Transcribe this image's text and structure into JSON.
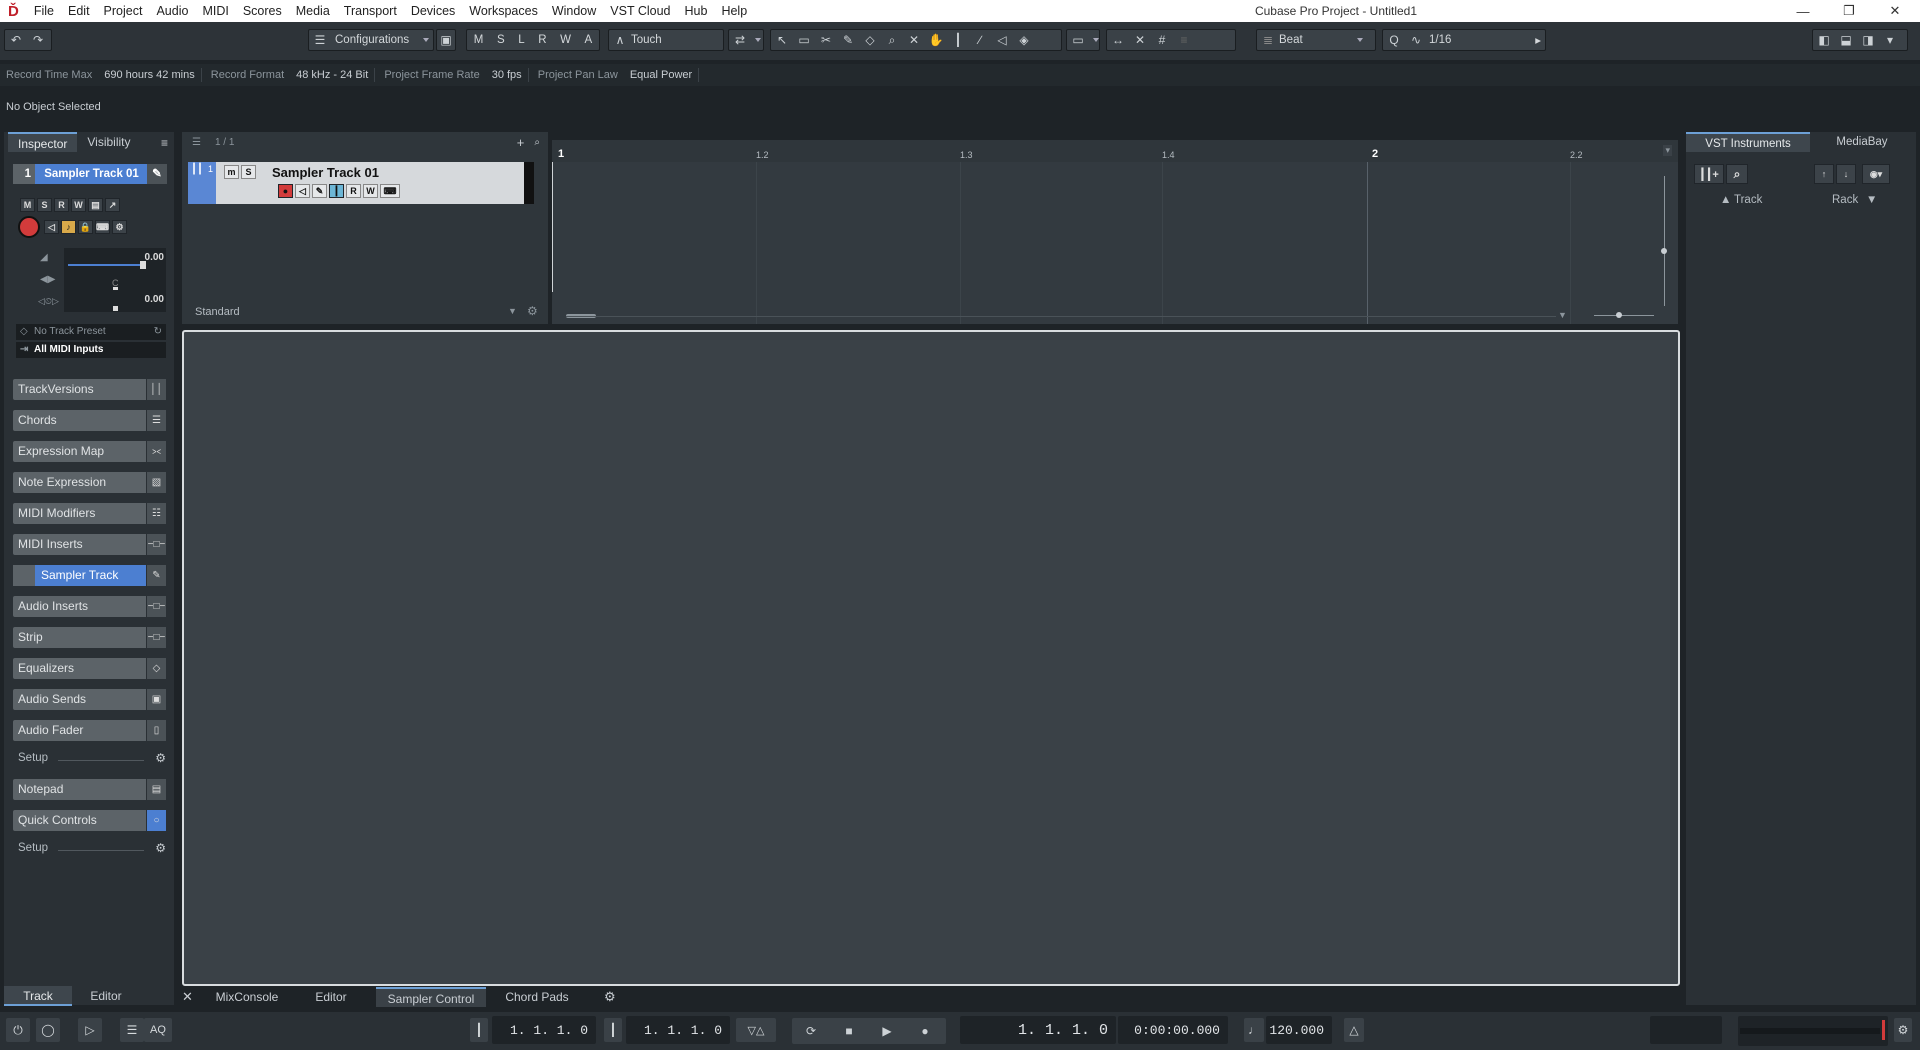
{
  "app": {
    "title": "Cubase Pro Project - Untitled1",
    "menu": [
      "File",
      "Edit",
      "Project",
      "Audio",
      "MIDI",
      "Scores",
      "Media",
      "Transport",
      "Devices",
      "Workspaces",
      "Window",
      "VST Cloud",
      "Hub",
      "Help"
    ]
  },
  "toolbar": {
    "configurations": "Configurations",
    "msrwa": [
      "M",
      "S",
      "L",
      "R",
      "W",
      "A"
    ],
    "automation_mode": "Touch",
    "snap_type": "Beat",
    "quantize_letter": "Q",
    "quantize_value": "1/16"
  },
  "info_line": {
    "record_time_max_label": "Record Time Max",
    "record_time_max_value": "690 hours 42 mins",
    "record_format_label": "Record Format",
    "record_format_value": "48 kHz - 24 Bit",
    "frame_rate_label": "Project Frame Rate",
    "frame_rate_value": "30 fps",
    "pan_law_label": "Project Pan Law",
    "pan_law_value": "Equal Power"
  },
  "object_selection": "No Object Selected",
  "inspector": {
    "tabs": [
      "Inspector",
      "Visibility"
    ],
    "track_number": "1",
    "track_name": "Sampler Track 01",
    "track_buttons": [
      "M",
      "S",
      "R",
      "W"
    ],
    "volume": "0.00",
    "pan_label": "C",
    "delay": "0.00",
    "no_track_preset": "No Track Preset",
    "midi_input": "All MIDI Inputs",
    "sections": [
      "TrackVersions",
      "Chords",
      "Expression Map",
      "Note Expression",
      "MIDI Modifiers",
      "MIDI Inserts",
      "Sampler Track",
      "Audio Inserts",
      "Strip",
      "Equalizers",
      "Audio Sends",
      "Audio Fader",
      "Setup",
      "Notepad",
      "Quick Controls",
      "Setup"
    ],
    "bottom_tabs": [
      "Track",
      "Editor"
    ]
  },
  "tracklist": {
    "count": "1 / 1",
    "track_name": "Sampler Track 01",
    "track_number": "1",
    "buttons": [
      "m",
      "S"
    ],
    "row_buttons": [
      "R",
      "W"
    ],
    "visibility_config": "Standard"
  },
  "ruler": {
    "labels": [
      "1",
      "1.2",
      "1.3",
      "1.4",
      "2",
      "2.2"
    ]
  },
  "lower_zone": {
    "tabs": [
      "MixConsole",
      "Editor",
      "Sampler Control",
      "Chord Pads"
    ],
    "active_tab": "Sampler Control"
  },
  "right_zone": {
    "tabs": [
      "VST Instruments",
      "MediaBay"
    ],
    "track_label": "Track",
    "rack_label": "Rack"
  },
  "transport": {
    "left_locator": "1.  1.  1.   0",
    "right_locator": "1.  1.  1.   0",
    "primary_time": "1.  1.  1.   0",
    "secondary_time": "0:00:00.000",
    "tempo": "120.000",
    "aq": "AQ"
  },
  "colors": {
    "accent_blue": "#4c7fd1",
    "record_red": "#d23b3b",
    "frame": "#d8dcdf"
  }
}
